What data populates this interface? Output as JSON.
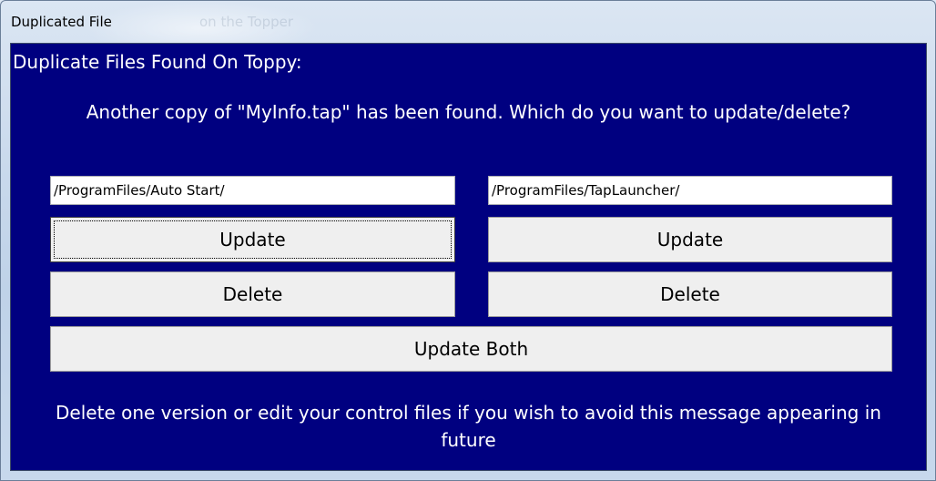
{
  "window": {
    "title": "Duplicated File",
    "background_ghost_text": "on the Topper"
  },
  "dialog": {
    "heading": "Duplicate Files Found On Toppy:",
    "message": "Another copy of \"MyInfo.tap\" has been found. Which do you want to update/delete?",
    "left": {
      "path": "/ProgramFiles/Auto Start/",
      "update_label": "Update",
      "delete_label": "Delete"
    },
    "right": {
      "path": "/ProgramFiles/TapLauncher/",
      "update_label": "Update",
      "delete_label": "Delete"
    },
    "update_both_label": "Update Both",
    "footer": "Delete one version or edit your control files if you wish to avoid this message appearing in future"
  },
  "colors": {
    "client_background": "#000080",
    "button_face": "#efefef",
    "text_on_client": "#ffffff"
  }
}
